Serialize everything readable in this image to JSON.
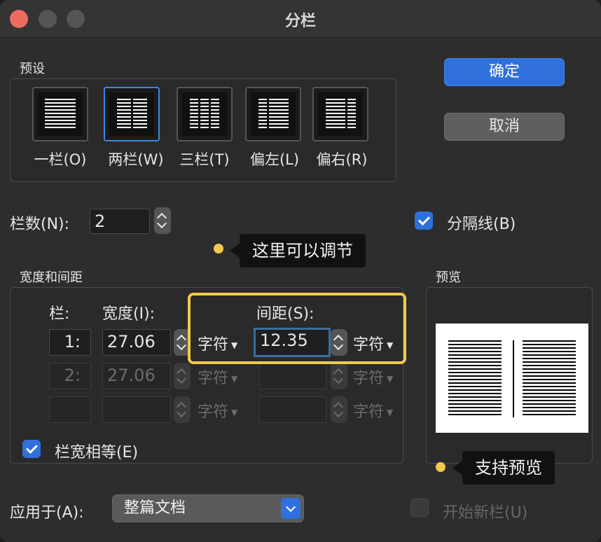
{
  "window": {
    "title": "分栏"
  },
  "presets": {
    "section_label": "预设",
    "items": [
      {
        "label": "一栏(O)",
        "icon": "one-column-icon"
      },
      {
        "label": "两栏(W)",
        "icon": "two-column-icon",
        "selected": true
      },
      {
        "label": "三栏(T)",
        "icon": "three-column-icon"
      },
      {
        "label": "偏左(L)",
        "icon": "left-column-icon"
      },
      {
        "label": "偏右(R)",
        "icon": "right-column-icon"
      }
    ]
  },
  "buttons": {
    "ok": "确定",
    "cancel": "取消"
  },
  "columns": {
    "label": "栏数(N):",
    "value": "2"
  },
  "separator": {
    "label": "分隔线(B)",
    "checked": true
  },
  "callouts": {
    "adjust": "这里可以调节",
    "preview": "支持预览"
  },
  "width_spacing": {
    "section_label": "宽度和间距",
    "col_header": "栏:",
    "width_header": "宽度(I):",
    "spacing_header": "间距(S):",
    "rows": [
      {
        "index": "1:",
        "width": "27.06",
        "width_unit": "字符",
        "spacing": "12.35",
        "spacing_unit": "字符"
      },
      {
        "index": "2:",
        "width": "27.06",
        "width_unit": "字符",
        "spacing": "",
        "spacing_unit": "字符"
      },
      {
        "index": "",
        "width": "",
        "width_unit": "字符",
        "spacing": "",
        "spacing_unit": "字符"
      }
    ],
    "equal_width": {
      "label": "栏宽相等(E)",
      "checked": true
    }
  },
  "preview": {
    "section_label": "预览"
  },
  "apply_to": {
    "label": "应用于(A):",
    "value": "整篇文档"
  },
  "new_column": {
    "label": "开始新栏(U)",
    "checked": false
  },
  "colors": {
    "accent": "#2f70dc",
    "highlight": "#f2c94c"
  }
}
